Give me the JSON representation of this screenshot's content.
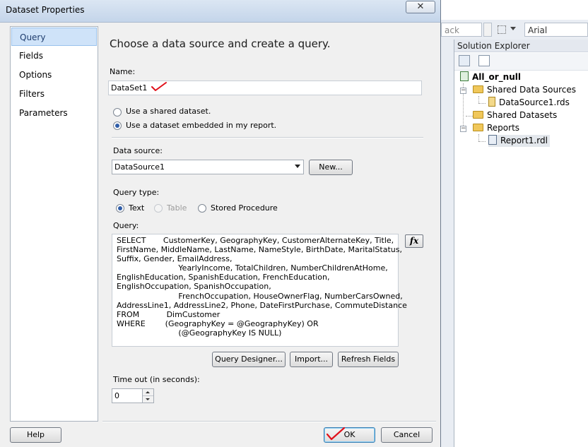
{
  "ide": {
    "toolbar": {
      "back_box": "ack",
      "font_box": "Arial"
    },
    "solution_explorer": {
      "title": "Solution Explorer",
      "project": "All_or_null",
      "shared_data_sources": "Shared Data Sources",
      "data_source_file": "DataSource1.rds",
      "shared_datasets": "Shared Datasets",
      "reports": "Reports",
      "report_file": "Report1.rdl"
    }
  },
  "dialog": {
    "title": "Dataset Properties",
    "close_glyph": "✕",
    "nav": [
      "Query",
      "Fields",
      "Options",
      "Filters",
      "Parameters"
    ],
    "selected_nav": "Query",
    "heading": "Choose a data source and create a query.",
    "name_label": "Name:",
    "name_value": "DataSet1",
    "radio_shared": "Use a shared dataset.",
    "radio_embedded": "Use a dataset embedded in my report.",
    "radio_selected": "embedded",
    "datasource_label": "Data source:",
    "datasource_value": "DataSource1",
    "new_button": "New...",
    "query_type_label": "Query type:",
    "query_type_text": "Text",
    "query_type_table": "Table",
    "query_type_stored": "Stored Procedure",
    "query_type_selected": "Text",
    "query_label": "Query:",
    "query_text": "SELECT       CustomerKey, GeographyKey, CustomerAlternateKey, Title,\nFirstName, MiddleName, LastName, NameStyle, BirthDate, MaritalStatus,\nSuffix, Gender, EmailAddress,\n                         YearlyIncome, TotalChildren, NumberChildrenAtHome,\nEnglishEducation, SpanishEducation, FrenchEducation,\nEnglishOccupation, SpanishOccupation,\n                         FrenchOccupation, HouseOwnerFlag, NumberCarsOwned,\nAddressLine1, AddressLine2, Phone, DateFirstPurchase, CommuteDistance\nFROM           DimCustomer\nWHERE        (GeographyKey = @GeographyKey) OR\n                         (@GeographyKey IS NULL)",
    "fx_glyph": "fx",
    "query_designer_button": "Query Designer...",
    "import_button": "Import...",
    "refresh_fields_button": "Refresh Fields",
    "timeout_label": "Time out (in seconds):",
    "timeout_value": "0",
    "help_button": "Help",
    "ok_button": "OK",
    "cancel_button": "Cancel",
    "annotation_color": "#e0101a"
  }
}
